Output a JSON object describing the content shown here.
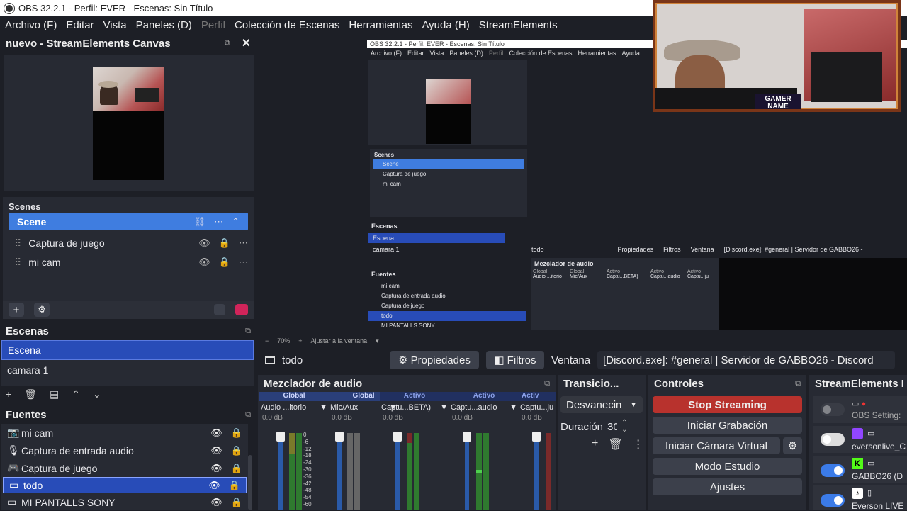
{
  "window": {
    "title": "OBS 32.2.1 - Perfil: EVER - Escenas: Sin Título"
  },
  "menu": [
    "Archivo (F)",
    "Editar",
    "Vista",
    "Paneles (D)",
    "Perfil",
    "Colección de Escenas",
    "Herramientas",
    "Ayuda (H)",
    "StreamElements"
  ],
  "canvas_dock": {
    "title": "nuevo - StreamElements Canvas"
  },
  "scenes_dock": {
    "title": "Scenes",
    "items": [
      "Scene",
      "Captura de juego",
      "mi cam"
    ]
  },
  "escenas_dock": {
    "title": "Escenas",
    "items": [
      "Escena",
      "camara 1"
    ]
  },
  "fuentes_dock": {
    "title": "Fuentes",
    "items": [
      "mi cam",
      "Captura de entrada audio",
      "Captura de juego",
      "todo",
      "MI PANTALLS SONY"
    ]
  },
  "preview": {
    "zoom": "70%",
    "fit_label": "Ajustar a la ventana",
    "overlay_text": "GAMER NAME"
  },
  "source_bar": {
    "name": "todo",
    "props": "Propiedades",
    "filters": "Filtros",
    "window_label": "Ventana",
    "window_value": "[Discord.exe]: #general | Servidor de GABBO26 - Discord"
  },
  "mixer": {
    "title": "Mezclador de audio",
    "channels": [
      {
        "tag": "Global",
        "name": "Audio ...itorio",
        "db": "0.0 dB"
      },
      {
        "tag": "Global",
        "name": "Mic/Aux",
        "db": "0.0 dB"
      },
      {
        "tag": "Activo",
        "name": "Captu...BETA)",
        "db": "0.0 dB"
      },
      {
        "tag": "Activo",
        "name": "Captu...audio",
        "db": "0.0 dB"
      },
      {
        "tag": "Activ",
        "name": "Captu...ju",
        "db": "0.0 dB"
      }
    ],
    "scale": [
      "0",
      "-6",
      "-12",
      "-18",
      "-24",
      "-30",
      "-36",
      "-42",
      "-48",
      "-54",
      "-60"
    ]
  },
  "transitions": {
    "title": "Transicio...",
    "type": "Desvanecin",
    "duration_label": "Duración",
    "duration_value": "30"
  },
  "controls": {
    "title": "Controles",
    "stop": "Stop Streaming",
    "record": "Iniciar Grabación",
    "vcam": "Iniciar Cámara Virtual",
    "studio": "Modo Estudio",
    "settings": "Ajustes"
  },
  "se_dock": {
    "title": "StreamElements I",
    "rows": [
      "OBS Setting:",
      "eversonlive_C",
      "GABBO26 (D",
      "Everson LIVE"
    ]
  },
  "nested": {
    "title": "OBS 32.2.1 - Perfil: EVER - Escenas: Sin Título",
    "menu": [
      "Archivo (F)",
      "Editar",
      "Vista",
      "Paneles (D)",
      "Perfil",
      "Colección de Escenas",
      "Herramientas",
      "Ayuda"
    ],
    "scenes": [
      "Scene",
      "Captura de juego",
      "mi cam"
    ],
    "escenas": [
      "Escena",
      "camara 1"
    ],
    "fuentes": [
      "mi cam",
      "Captura de entrada audio",
      "Captura de juego",
      "todo",
      "MI PANTALLS SONY"
    ],
    "source": "todo",
    "props": "Propiedades",
    "filters": "Filtros",
    "window_label": "Ventana",
    "window_value": "[Discord.exe]: #general | Servidor de GABBO26 -",
    "mixer_title": "Mezclador de audio",
    "channels": [
      "Audio ...itorio",
      "Mic/Aux",
      "Captu...BETA)",
      "Captu...audio",
      "Captu...ju"
    ],
    "tags": [
      "Global",
      "Global",
      "Activo",
      "Activo",
      "Activo"
    ],
    "zoom": "70%",
    "fit": "Ajustar a la ventana",
    "scenes_title": "Scenes",
    "escenas_title": "Escenas",
    "fuentes_title": "Fuentes"
  }
}
